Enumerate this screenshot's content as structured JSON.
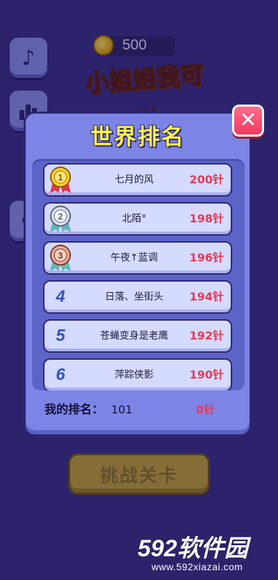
{
  "game": {
    "coins": "500",
    "logo_text": "小姐姐我可以",
    "challenge_button": "挑战关卡"
  },
  "side_buttons": [
    {
      "icon": "music-note-icon"
    },
    {
      "icon": "rank-bars-icon"
    },
    {
      "icon": "share-icon"
    }
  ],
  "modal": {
    "title": "世界排名",
    "close_label": "✕"
  },
  "leaderboard": [
    {
      "rank": "1",
      "badge": "gold",
      "name": "七月的风",
      "score": "200针"
    },
    {
      "rank": "2",
      "badge": "silver",
      "name": "北陌°",
      "score": "198针"
    },
    {
      "rank": "3",
      "badge": "bronze",
      "name": "午夜↑蓝调",
      "score": "196针"
    },
    {
      "rank": "4",
      "badge": "",
      "name": "日落、坐街头",
      "score": "194针"
    },
    {
      "rank": "5",
      "badge": "",
      "name": "苍蝇变身是老鹰",
      "score": "192针"
    },
    {
      "rank": "6",
      "badge": "",
      "name": "萍踪侠影",
      "score": "190针"
    }
  ],
  "my_rank": {
    "label": "我的排名：",
    "value": "101",
    "score": "0针"
  },
  "watermark": {
    "main": "592软件园",
    "url": "www.592xiazai.com"
  },
  "colors": {
    "background": "#3a2f86",
    "modal": "#7c85e6",
    "title": "#fff34a",
    "score": "#e43a56",
    "close": "#f03a5e"
  }
}
